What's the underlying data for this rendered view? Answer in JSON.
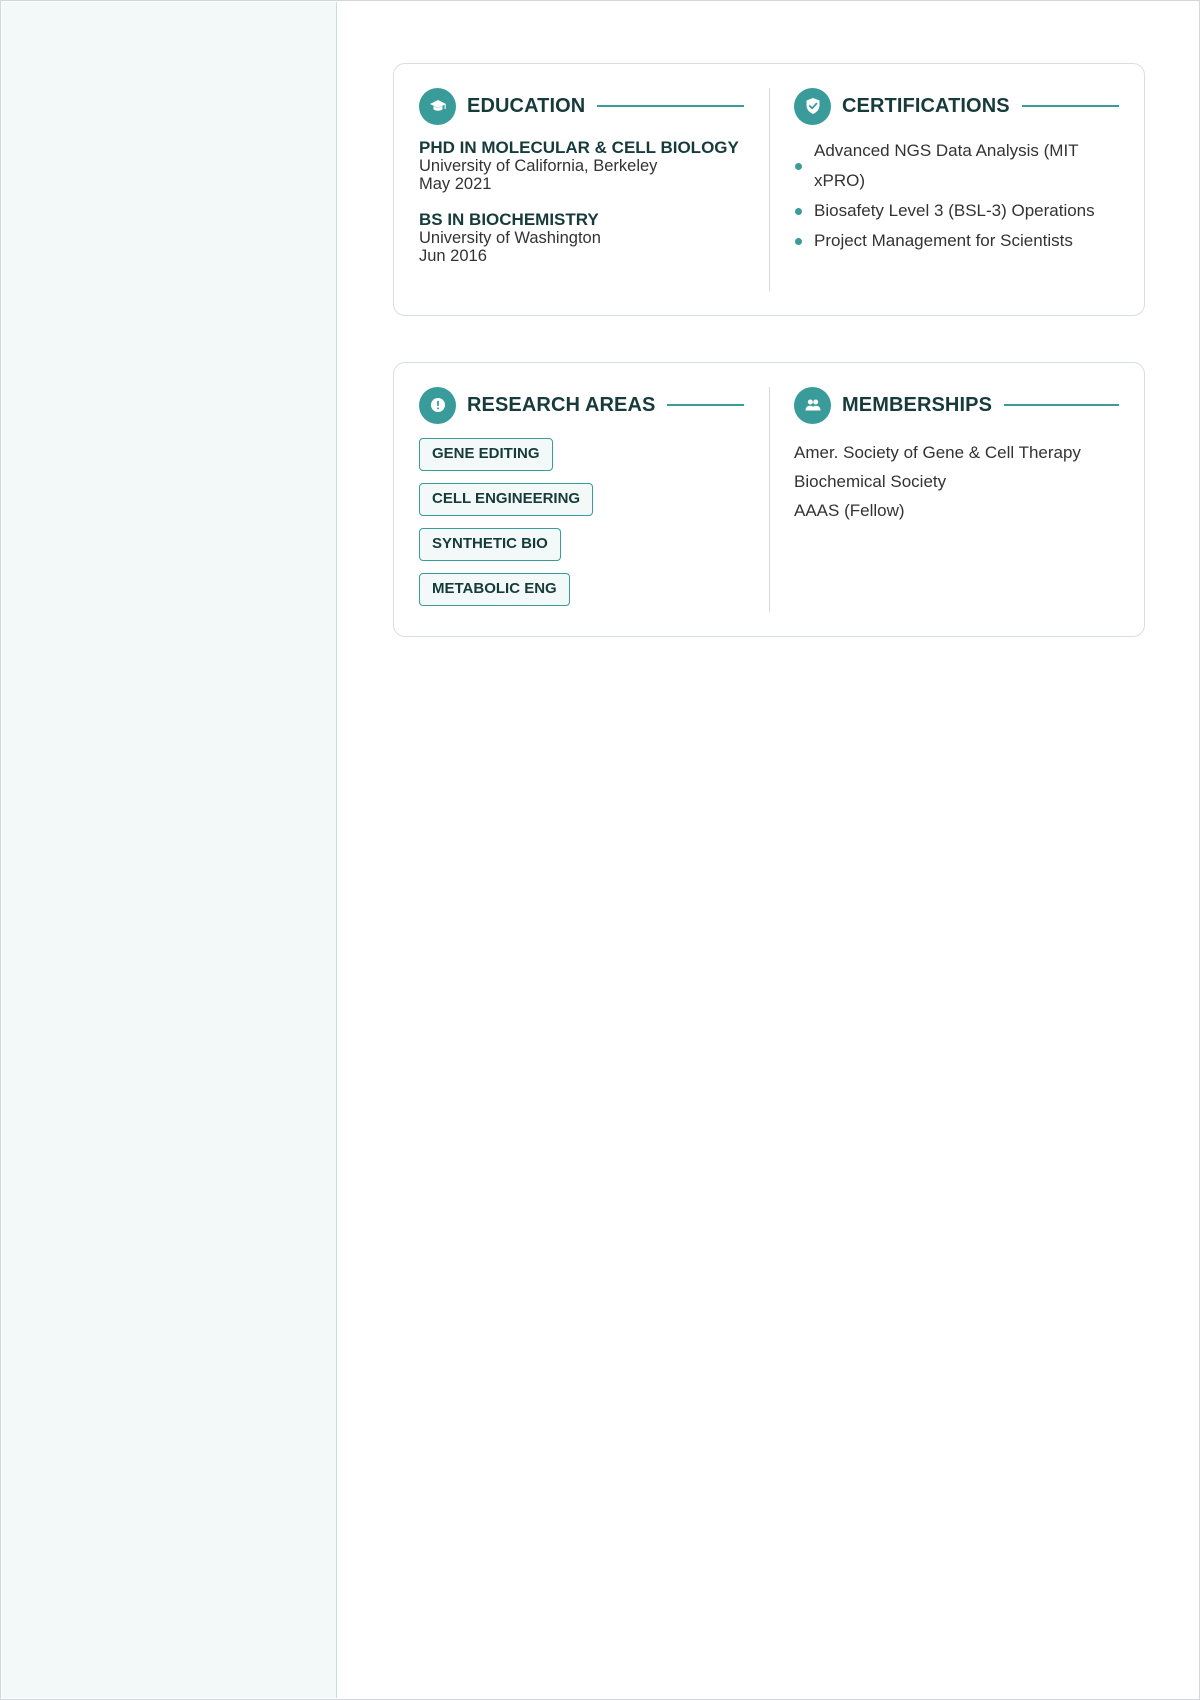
{
  "education": {
    "title": "EDUCATION",
    "items": [
      {
        "degree": "PHD IN MOLECULAR & CELL BIOLOGY",
        "school": "University of California, Berkeley",
        "date": "May 2021"
      },
      {
        "degree": "BS IN BIOCHEMISTRY",
        "school": "University of Washington",
        "date": "Jun 2016"
      }
    ]
  },
  "certifications": {
    "title": "CERTIFICATIONS",
    "items": [
      "Advanced NGS Data Analysis (MIT xPRO)",
      "Biosafety Level 3 (BSL-3) Operations",
      "Project Management for Scientists"
    ]
  },
  "research_areas": {
    "title": "RESEARCH AREAS",
    "tags": [
      "GENE EDITING",
      "CELL ENGINEERING",
      "SYNTHETIC BIO",
      "METABOLIC ENG"
    ]
  },
  "memberships": {
    "title": "MEMBERSHIPS",
    "items": [
      "Amer. Society of Gene & Cell Therapy",
      "Biochemical Society",
      "AAAS (Fellow)"
    ]
  },
  "icons": {
    "education": "graduation-cap-icon",
    "certifications": "shield-check-icon",
    "research_areas": "alert-circle-icon",
    "memberships": "users-icon"
  },
  "colors": {
    "accent": "#3a9b9b",
    "heading": "#173b3b",
    "sidebar_bg": "#f3f8f9"
  }
}
